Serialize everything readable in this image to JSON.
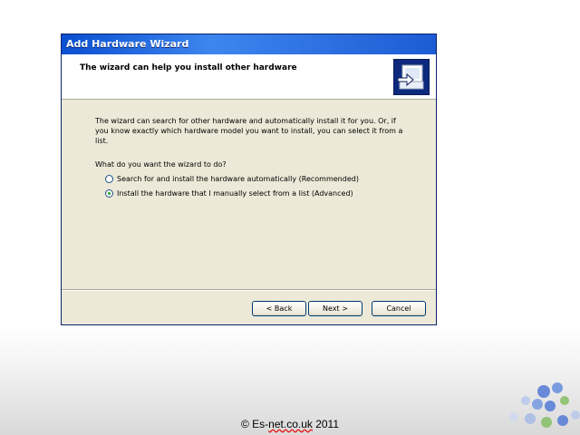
{
  "window": {
    "title": "Add Hardware Wizard"
  },
  "header": {
    "title": "The wizard can help you install other hardware",
    "icon": "hardware-install-icon"
  },
  "body": {
    "description": "The wizard can search for other hardware and automatically install it for you. Or, if you know exactly which hardware model you want to install, you can select it from a list.",
    "question": "What do you want the wizard to do?",
    "options": [
      {
        "label": "Search for and install the hardware automatically (Recommended)",
        "selected": false
      },
      {
        "label": "Install the hardware that I manually select from a list (Advanced)",
        "selected": true
      }
    ]
  },
  "buttons": {
    "back": "< Back",
    "next": "Next >",
    "cancel": "Cancel"
  },
  "footer": {
    "copyright_prefix": "© Es-",
    "copyright_underlined": "net.co.uk",
    "copyright_suffix": " 2011"
  },
  "colors": {
    "title_bar": "#0a4fd1",
    "dialog_bg": "#ece9d8",
    "radio_selected": "#21a121",
    "logo_blue": "#5a7fd6",
    "logo_green": "#8ac06b"
  }
}
